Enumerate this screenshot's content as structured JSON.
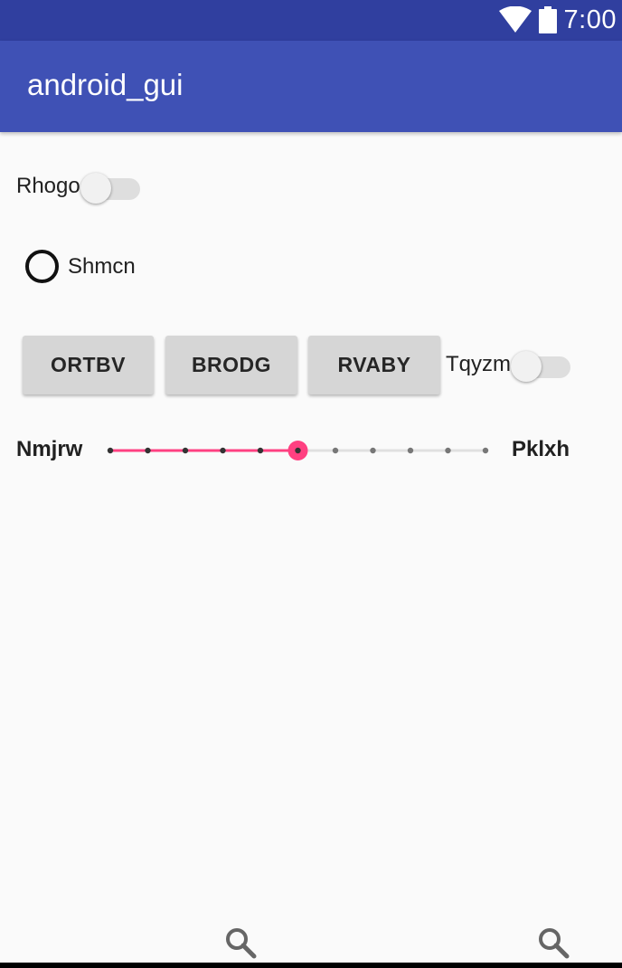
{
  "status_bar": {
    "time": "7:00",
    "icons": [
      "wifi-icon",
      "battery-icon"
    ]
  },
  "app_bar": {
    "title": "android_gui"
  },
  "switch_1": {
    "label": "Rhogo",
    "checked": false
  },
  "radio_1": {
    "label": "Shmcn",
    "checked": false
  },
  "buttons": [
    "ORTBV",
    "BRODG",
    "RVABY"
  ],
  "switch_2": {
    "label": "Tqyzm",
    "checked": false
  },
  "seekbar": {
    "left_label": "Nmjrw",
    "right_label": "Pklxh",
    "max": 10,
    "value": 5
  },
  "bottom": {
    "icons": [
      "search-icon",
      "search-icon"
    ]
  },
  "colors": {
    "status_bar": "#303f9f",
    "app_bar": "#3f51b5",
    "accent": "#ff4081",
    "background": "#fafafa"
  }
}
